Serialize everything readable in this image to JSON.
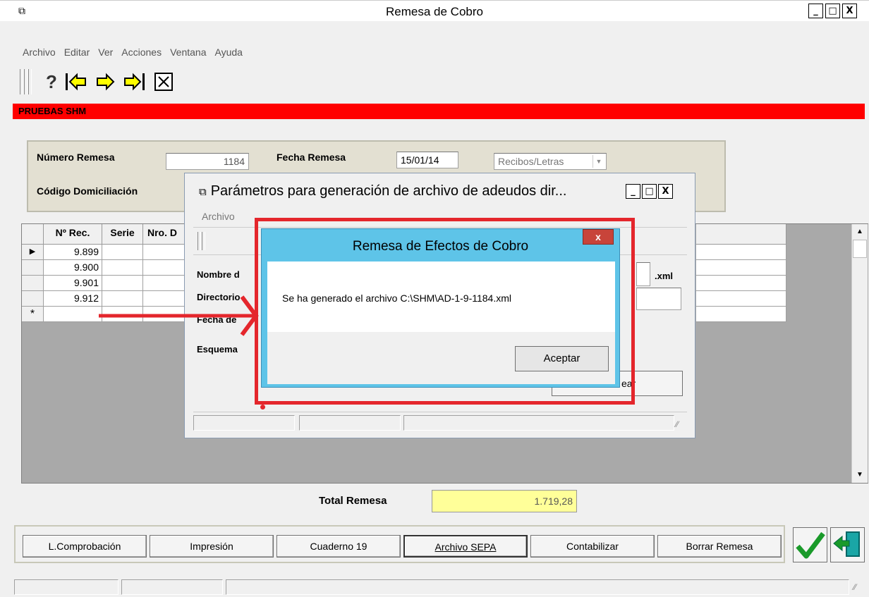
{
  "window": {
    "title": "Remesa de Cobro",
    "controls": [
      "_",
      "□",
      "X"
    ]
  },
  "menu": [
    "Archivo",
    "Editar",
    "Ver",
    "Acciones",
    "Ventana",
    "Ayuda"
  ],
  "company_bar": "PRUEBAS SHM",
  "form": {
    "numero_label": "Número Remesa",
    "numero_value": "1184",
    "fecha_label": "Fecha Remesa",
    "fecha_value": "15/01/14",
    "tipo_value": "Recibos/Letras",
    "domiciliacion_label": "Código Domiciliación"
  },
  "grid": {
    "headers": [
      "Nº Rec.",
      "Serie",
      "Nro. D"
    ],
    "rows": [
      {
        "marker": "▶",
        "rec": "9.899"
      },
      {
        "marker": "",
        "rec": "9.900"
      },
      {
        "marker": "",
        "rec": "9.901"
      },
      {
        "marker": "",
        "rec": "9.912"
      },
      {
        "marker": "*",
        "rec": ""
      }
    ]
  },
  "total": {
    "label": "Total Remesa",
    "value": "1.719,28"
  },
  "buttons": [
    "L.Comprobación",
    "Impresión",
    "Cuaderno 19",
    "Archivo SEPA",
    "Contabilizar",
    "Borrar Remesa"
  ],
  "dialog": {
    "title": "Parámetros para generación de archivo de adeudos dir...",
    "menu": "Archivo",
    "labels": [
      "Nombre d",
      "Directorio",
      "Fecha de",
      "Esquema"
    ],
    "ext": ".xml",
    "partial_button": "ear"
  },
  "message_box": {
    "title": "Remesa de Efectos de Cobro",
    "message": "Se ha generado el archivo C:\\SHM\\AD-1-9-1184.xml",
    "ok": "Aceptar",
    "close": "x"
  },
  "colors": {
    "red_bar": "#ff0000",
    "annotation": "#e4262c",
    "msg_title": "#5ec4e8",
    "total_bg": "#ffff99"
  }
}
